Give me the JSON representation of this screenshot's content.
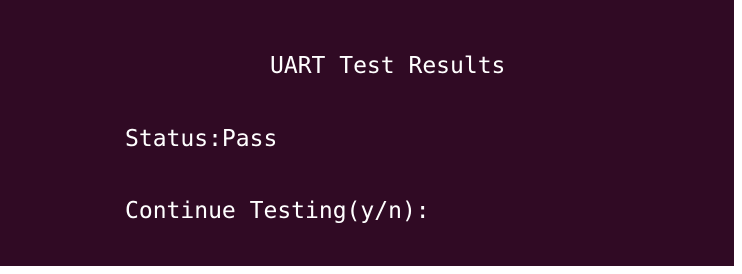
{
  "terminal": {
    "title": "UART Test Results",
    "status_line": "Status:Pass",
    "prompt": "Continue Testing(y/n):",
    "colors": {
      "background": "#300a24",
      "text": "#ffffff"
    }
  }
}
